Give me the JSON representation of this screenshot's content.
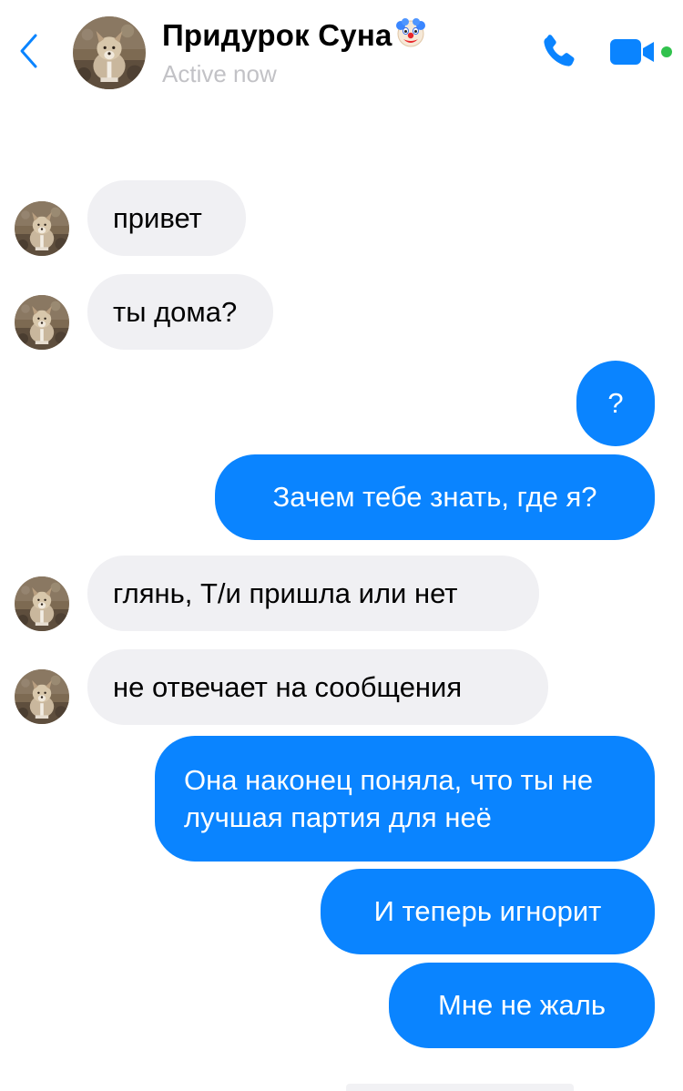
{
  "header": {
    "contact_name": "Придурок Суна",
    "status": "Active now",
    "icons": {
      "back": "chevron-left-icon",
      "call": "phone-icon",
      "video": "video-camera-icon",
      "name_emoji": "clown-face-emoji"
    }
  },
  "colors": {
    "accent": "#0a84ff",
    "incoming_bubble": "#f0f0f3",
    "outgoing_bubble": "#0a84ff",
    "online_dot": "#31c24d",
    "status_text": "#c2c2c6"
  },
  "messages": [
    {
      "direction": "incoming",
      "text": "привет"
    },
    {
      "direction": "incoming",
      "text": "ты дома?"
    },
    {
      "direction": "outgoing",
      "text": "?"
    },
    {
      "direction": "outgoing",
      "text": "Зачем тебе знать, где я?"
    },
    {
      "direction": "incoming",
      "text": "глянь, Т/и пришла или нет"
    },
    {
      "direction": "incoming",
      "text": "не отвечает на сообщения"
    },
    {
      "direction": "outgoing",
      "text": "Она наконец поняла, что ты не лучшая партия для неё"
    },
    {
      "direction": "outgoing",
      "text": "И теперь игнорит"
    },
    {
      "direction": "outgoing",
      "text": "Мне не жаль"
    }
  ]
}
